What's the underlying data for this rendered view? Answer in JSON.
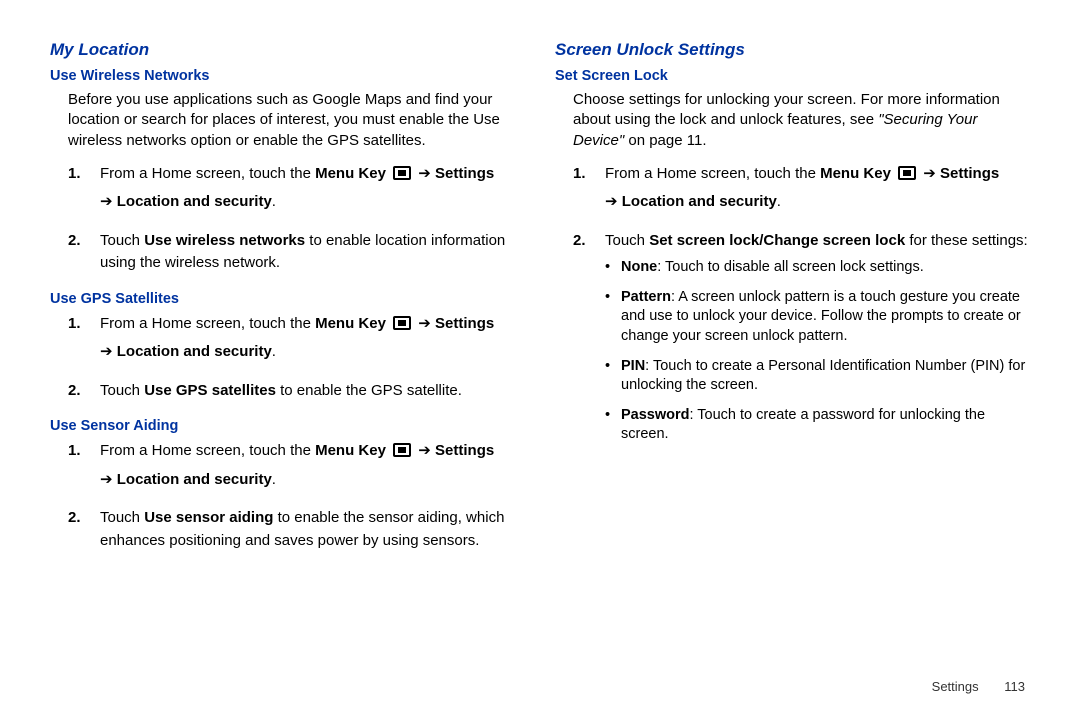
{
  "left": {
    "heading": "My Location",
    "s1": {
      "title": "Use Wireless Networks",
      "intro": "Before you use applications such as Google Maps and find your location or search for places of interest, you must enable the Use wireless networks option or enable the GPS satellites.",
      "step1_pre": "From a Home screen, touch the ",
      "menu_key": "Menu Key",
      "settings": "Settings",
      "loc_sec": "Location and security",
      "step2_a": "Touch ",
      "step2_b": "Use wireless networks",
      "step2_c": " to enable location information using the wireless network."
    },
    "s2": {
      "title": "Use GPS Satellites",
      "step2_a": "Touch ",
      "step2_b": "Use GPS satellites",
      "step2_c": " to enable the GPS satellite."
    },
    "s3": {
      "title": "Use Sensor Aiding",
      "step2_a": "Touch ",
      "step2_b": "Use sensor aiding",
      "step2_c": " to enable the sensor aiding, which enhances positioning and saves power by using sensors."
    }
  },
  "right": {
    "heading": "Screen Unlock Settings",
    "s1": {
      "title": "Set Screen Lock",
      "intro_a": "Choose settings for unlocking your screen. For more information about using the lock and unlock features, see ",
      "intro_ref": "\"Securing Your Device\"",
      "intro_b": " on page 11.",
      "step2_a": "Touch ",
      "step2_b": "Set screen lock/Change screen lock",
      "step2_c": " for these settings:",
      "b1_l": "None",
      "b1_t": ": Touch to disable all screen lock settings.",
      "b2_l": "Pattern",
      "b2_t": ": A screen unlock pattern is a touch gesture you create and use to unlock your device. Follow the prompts to create or change your screen unlock pattern.",
      "b3_l": "PIN",
      "b3_t": ": Touch to create a Personal Identification Number (PIN) for unlocking the screen.",
      "b4_l": "Password",
      "b4_t": ": Touch to create a password for unlocking the screen."
    }
  },
  "nav": {
    "arrow": " ➔ "
  },
  "footer": {
    "section": "Settings",
    "page": "113"
  }
}
